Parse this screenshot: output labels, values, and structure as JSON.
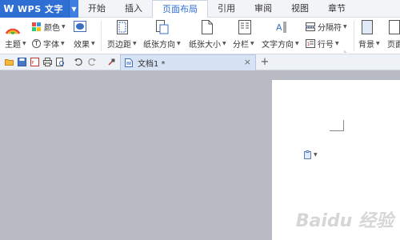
{
  "app": {
    "logo": "W",
    "name": "WPS 文字"
  },
  "menu_tabs": [
    "开始",
    "插入",
    "页面布局",
    "引用",
    "审阅",
    "视图",
    "章节"
  ],
  "active_tab_index": 2,
  "ribbon": {
    "theme": "主题",
    "color": "颜色",
    "font": "字体",
    "effect": "效果",
    "margins": "页边距",
    "orientation": "纸张方向",
    "size": "纸张大小",
    "columns": "分栏",
    "text_direction": "文字方向",
    "breaks": "分隔符",
    "line_numbers": "行号",
    "background": "背景",
    "page_border": "页面"
  },
  "document_tab": {
    "label": "文档1 *",
    "close": "×"
  },
  "new_tab_symbol": "+",
  "watermark": "Baidu 经验",
  "colors": {
    "accent": "#2f6fd3",
    "canvas": "#b9bbc4",
    "page": "#ffffff"
  }
}
